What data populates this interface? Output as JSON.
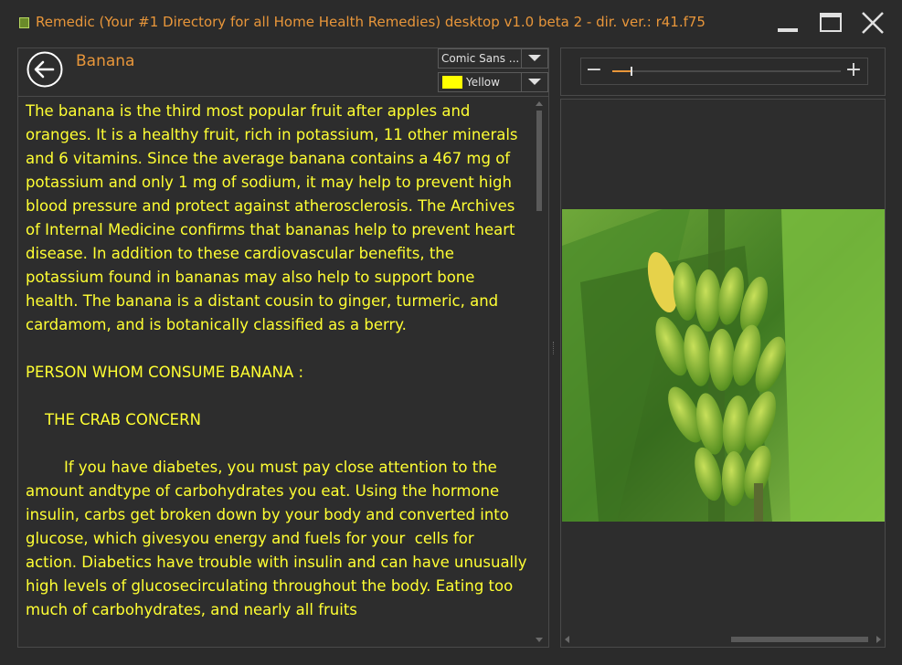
{
  "window": {
    "title": "Remedic (Your #1 Directory for all Home Health Remedies) desktop v1.0 beta 2 - dir. ver.: r41.f75"
  },
  "header": {
    "page_title": "Banana",
    "font_dropdown": "Comic Sans ...",
    "color_dropdown": "Yellow"
  },
  "zoom": {
    "minus_label": "−",
    "plus_label": "+",
    "level_fraction": 0.08
  },
  "content": {
    "paragraphs": [
      "The banana is the third most popular fruit after apples and oranges. It is a healthy fruit, rich in potassium, 11 other minerals and 6 vitamins. Since the average banana contains a 467 mg of potassium and only 1 mg of sodium, it may help to prevent high blood pressure and protect against atherosclerosis. The Archives of Internal Medicine confirms that bananas help to prevent heart disease. In addition to these cardiovascular benefits, the potassium found in bananas may also help to support bone health. The banana is a distant cousin to ginger, turmeric, and cardamom, and is botanically classified as a berry.",
      "PERSON WHOM CONSUME BANANA :",
      "    THE CRAB CONCERN",
      "        If you have diabetes, you must pay close attention to the amount andtype of carbohydrates you eat. Using the hormone insulin, carbs get broken down by your body and converted into glucose, which givesyou energy and fuels for your  cells for action. Diabetics have trouble with insulin and can have unusually high levels of glucosecirculating throughout the body. Eating too much of carbohydrates, and nearly all fruits"
    ]
  },
  "colors": {
    "accent": "#e8963a",
    "text": "#ffff33",
    "background": "#2b2b2b"
  },
  "icons": {
    "back": "arrow-left-circle-icon",
    "minimize": "minimize-icon",
    "maximize": "maximize-icon",
    "close": "close-icon"
  }
}
